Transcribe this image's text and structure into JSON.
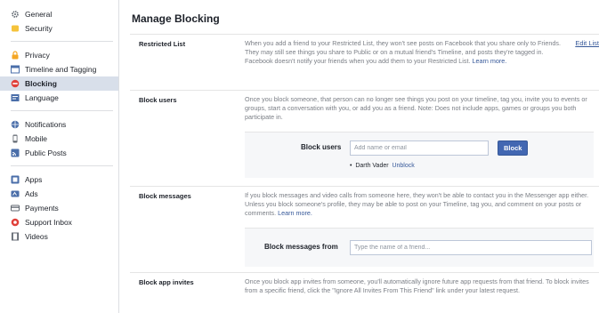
{
  "sidebar": {
    "groups": [
      [
        {
          "label": "General",
          "icon": "gear-icon",
          "color": "#606770"
        },
        {
          "label": "Security",
          "icon": "shield-icon",
          "color": "#f5c33b"
        }
      ],
      [
        {
          "label": "Privacy",
          "icon": "lock-icon",
          "color": "#f5a623"
        },
        {
          "label": "Timeline and Tagging",
          "icon": "timeline-icon",
          "color": "#4a6ea9"
        },
        {
          "label": "Blocking",
          "icon": "block-icon",
          "color": "#e0403a",
          "active": true
        },
        {
          "label": "Language",
          "icon": "language-icon",
          "color": "#4a6ea9"
        }
      ],
      [
        {
          "label": "Notifications",
          "icon": "globe-icon",
          "color": "#4a6ea9"
        },
        {
          "label": "Mobile",
          "icon": "mobile-icon",
          "color": "#606770"
        },
        {
          "label": "Public Posts",
          "icon": "rss-icon",
          "color": "#4a6ea9"
        }
      ],
      [
        {
          "label": "Apps",
          "icon": "apps-icon",
          "color": "#4a6ea9"
        },
        {
          "label": "Ads",
          "icon": "ads-icon",
          "color": "#4a6ea9"
        },
        {
          "label": "Payments",
          "icon": "payments-icon",
          "color": "#606770"
        },
        {
          "label": "Support Inbox",
          "icon": "support-icon",
          "color": "#e0403a"
        },
        {
          "label": "Videos",
          "icon": "video-icon",
          "color": "#606770"
        }
      ]
    ]
  },
  "page": {
    "title": "Manage Blocking"
  },
  "restricted": {
    "title": "Restricted List",
    "desc": "When you add a friend to your Restricted List, they won't see posts on Facebook that you share only to Friends. They may still see things you share to Public or on a mutual friend's Timeline, and posts they're tagged in. Facebook doesn't notify your friends when you add them to your Restricted List.",
    "learn_more": "Learn more.",
    "edit_label": "Edit List"
  },
  "block_users": {
    "title": "Block users",
    "desc": "Once you block someone, that person can no longer see things you post on your timeline, tag you, invite you to events or groups, start a conversation with you, or add you as a friend. Note: Does not include apps, games or groups you both participate in.",
    "field_label": "Block users",
    "placeholder": "Add name or email",
    "button_label": "Block",
    "blocked": [
      {
        "name": "Darth Vader",
        "action": "Unblock"
      }
    ]
  },
  "block_messages": {
    "title": "Block messages",
    "desc": "If you block messages and video calls from someone here, they won't be able to contact you in the Messenger app either. Unless you block someone's profile, they may be able to post on your Timeline, tag you, and comment on your posts or comments.",
    "learn_more": "Learn more.",
    "field_label": "Block messages from",
    "placeholder": "Type the name of a friend..."
  },
  "block_app_invites": {
    "title": "Block app invites",
    "desc": "Once you block app invites from someone, you'll automatically ignore future app requests from that friend. To block invites from a specific friend, click the \"Ignore All Invites From This Friend\" link under your latest request."
  }
}
